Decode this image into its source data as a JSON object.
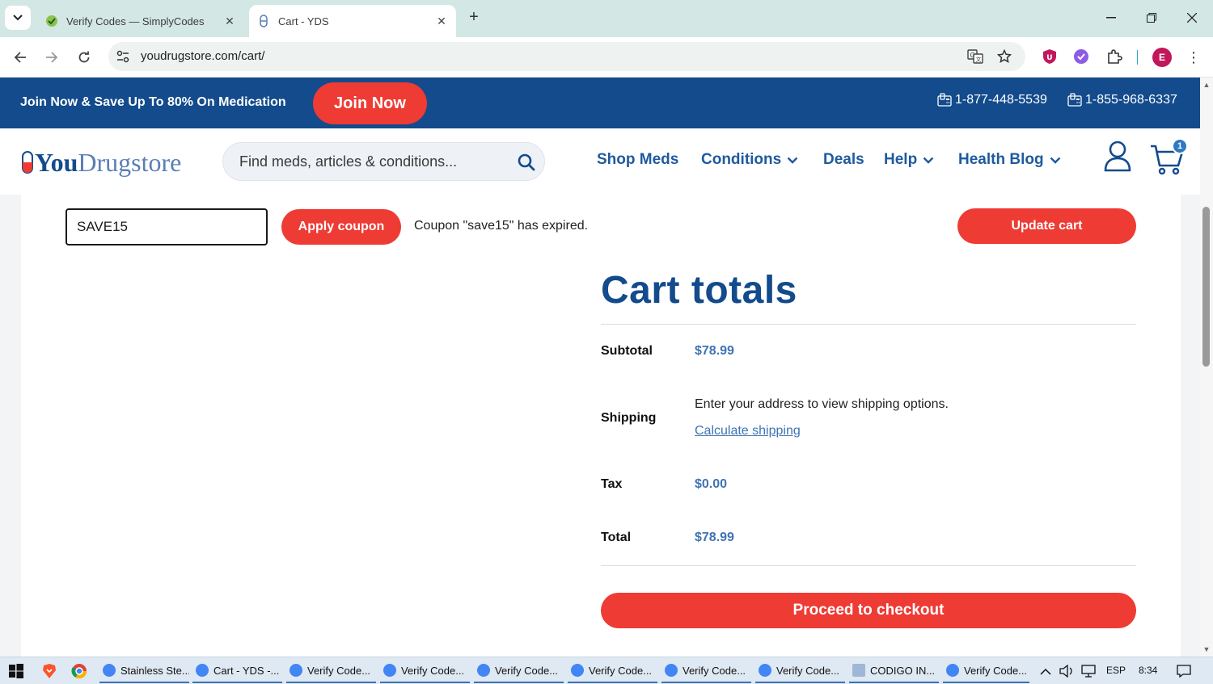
{
  "browser": {
    "tabs": [
      {
        "title": "Verify Codes — SimplyCodes",
        "active": false
      },
      {
        "title": "Cart - YDS",
        "active": true
      }
    ],
    "url": "youdrugstore.com/cart/",
    "avatar_letter": "E"
  },
  "promo": {
    "text": "Join Now & Save Up To 80% On Medication",
    "join_label": "Join Now",
    "phone1": "1-877-448-5539",
    "phone2": "1-855-968-6337"
  },
  "nav": {
    "logo_you": "You",
    "logo_drugstore": "Drugstore",
    "search_placeholder": "Find meds, articles & conditions...",
    "links": [
      "Shop Meds",
      "Conditions",
      "Deals",
      "Help",
      "Health Blog"
    ],
    "cart_count": "1"
  },
  "coupon": {
    "code": "SAVE15",
    "apply_label": "Apply coupon",
    "message": "Coupon \"save15\" has expired.",
    "update_label": "Update cart"
  },
  "totals": {
    "title": "Cart totals",
    "subtotal_label": "Subtotal",
    "subtotal": "$78.99",
    "shipping_label": "Shipping",
    "shipping_text": "Enter your address to view shipping options.",
    "shipping_link": "Calculate shipping",
    "tax_label": "Tax",
    "tax": "$0.00",
    "total_label": "Total",
    "total": "$78.99",
    "checkout_label": "Proceed to checkout"
  },
  "taskbar": {
    "apps": [
      "Stainless Ste...",
      "Cart - YDS -...",
      "Verify Code...",
      "Verify Code...",
      "Verify Code...",
      "Verify Code...",
      "Verify Code...",
      "Verify Code...",
      "CODIGO IN...",
      "Verify Code..."
    ],
    "lang": "ESP",
    "time": "8:34"
  },
  "colors": {
    "brand_blue": "#134b8c",
    "accent_red": "#ee3b34",
    "link_blue": "#3f73b3"
  }
}
